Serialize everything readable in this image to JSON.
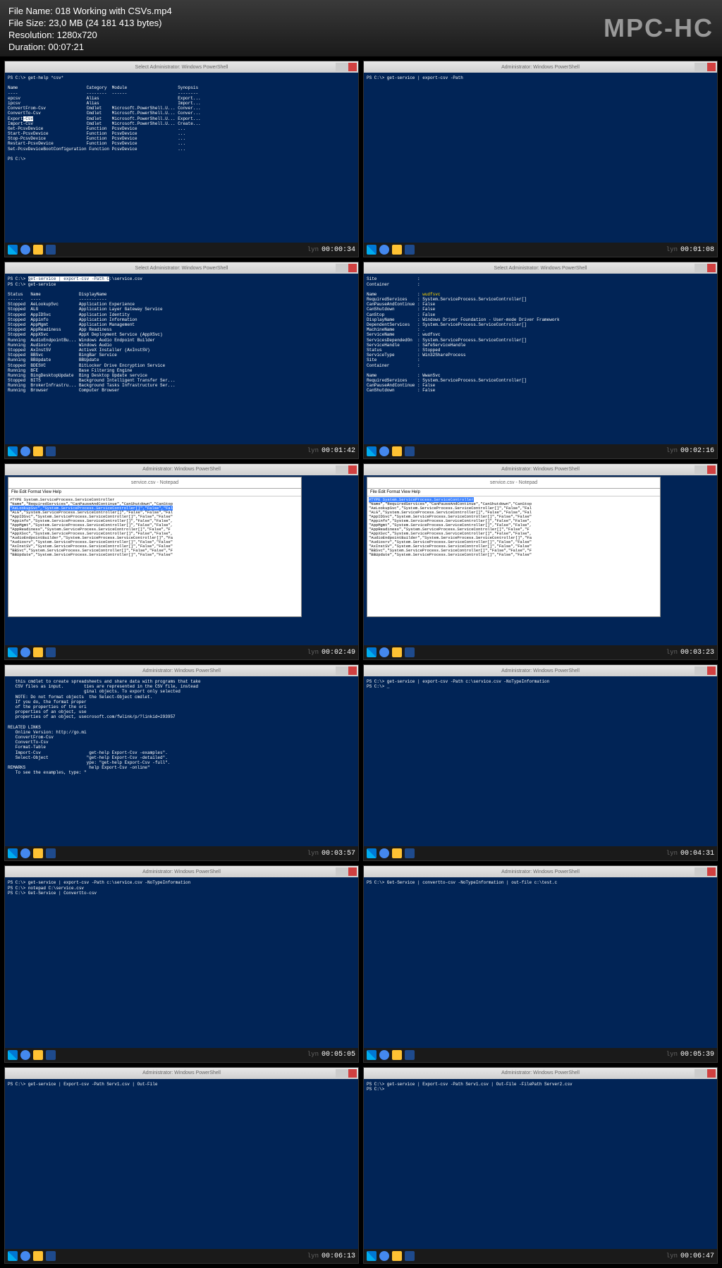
{
  "header": {
    "file_name": "File Name: 018 Working with CSVs.mp4",
    "file_size": "File Size: 23,0 MB (24 181 413 bytes)",
    "resolution": "Resolution: 1280x720",
    "duration": "Duration: 00:07:21",
    "logo": "MPC-HC"
  },
  "titlebars": {
    "ps": "Select Administrator: Windows PowerShell",
    "admin": "Administrator: Windows PowerShell",
    "np": "service.csv - Notepad",
    "np_menu": "File  Edit  Format  View  Help"
  },
  "thumbs": [
    {
      "ts": "00:00:34",
      "t": "ps",
      "body": "PS C:\\> get-help *csv*\n\nName                           Category  Module                    Synopsis\n----                           --------  ------                    --------\nepcsv                          Alias                               Export...\nipcsv                          Alias                               Import...\nConvertFrom-Csv                Cmdlet    Microsoft.PowerShell.U... Conver...\nConvertTo-Csv                  Cmdlet    Microsoft.PowerShell.U... Conver...\nExport-Csv                     Cmdlet    Microsoft.PowerShell.U... Export...\nImport-Csv                     Cmdlet    Microsoft.PowerShell.U... Create...\nGet-PcsvDevice                 Function  PcsvDevice                ...\nStart-PcsvDevice               Function  PcsvDevice                ...\nStop-PcsvDevice                Function  PcsvDevice                ...\nRestart-PcsvDevice             Function  PcsvDevice                ...\nSet-PcsvDeviceBootConfiguration Function PcsvDevice                ...\n\nPS C:\\>"
    },
    {
      "ts": "00:01:08",
      "t": "admin",
      "body": "PS C:\\> get-service | export-csv -Path"
    },
    {
      "ts": "00:01:42",
      "t": "ps",
      "body": "PS C:\\> get-service | export-csv -Path C:\\service.csv\nPS C:\\> get-service\n\nStatus   Name               DisplayName\n------   ----               -----------\nStopped  AeLookupSvc        Application Experience\nStopped  ALG                Application Layer Gateway Service\nStopped  AppIDSvc           Application Identity\nStopped  Appinfo            Application Information\nStopped  AppMgmt            Application Management\nStopped  AppReadiness       App Readiness\nStopped  AppXSvc            AppX Deployment Service (AppXSvc)\nRunning  AudioEndpointBu... Windows Audio Endpoint Builder\nRunning  Audiosrv           Windows Audio\nStopped  AxInstSV           ActiveX Installer (AxInstSV)\nStopped  BBSvc              BingBar Service\nRunning  BBUpdate           BBUpdate\nStopped  BDESVC             BitLocker Drive Encryption Service\nRunning  BFE                Base Filtering Engine\nRunning  BingDesktopUpdate  Bing Desktop Update service\nStopped  BITS               Background Intelligent Transfer Ser...\nRunning  BrokerInfrastru... Background Tasks Infrastructure Ser...\nRunning  Browser            Computer Browser"
    },
    {
      "ts": "00:02:16",
      "t": "ps",
      "body": "Site                :\nContainer           :\n\nName                : wudfsvc\nRequiredServices    : System.ServiceProcess.ServiceController[]\nCanPauseAndContinue : False\nCanShutdown         : False\nCanStop             : False\nDisplayName         : Windows Driver Foundation - User-mode Driver Framework\nDependentServices   : System.ServiceProcess.ServiceController[]\nMachineName         : .\nServiceName         : wudfsvc\nServicesDependedOn  : System.ServiceProcess.ServiceController[]\nServiceHandle       : SafeServiceHandle\nStatus              : Stopped\nServiceType         : Win32ShareProcess\nSite                :\nContainer           :\n\nName                : WwanSvc\nRequiredServices    : System.ServiceProcess.ServiceController[]\nCanPauseAndContinue : False\nCanShutdown         : False"
    },
    {
      "ts": "00:02:49",
      "t": "np",
      "body": "#TYPE System.ServiceProcess.ServiceController\n\"Name\",\"RequiredServices\",\"CanPauseAndContinue\",\"CanShutdown\",\"CanStop\n\"AeLookupSvc\",\"System.ServiceProcess.ServiceController[]\",\"False\",\"Fal\n\"ALG\",\"System.ServiceProcess.ServiceController[]\",\"False\",\"False\",\"Fal\n\"AppIDSvc\",\"System.ServiceProcess.ServiceController[]\",\"False\",\"False\"\n\"Appinfo\",\"System.ServiceProcess.ServiceController[]\",\"False\",\"False\",\n\"AppMgmt\",\"System.ServiceProcess.ServiceController[]\",\"False\",\"False\",\n\"AppReadiness\",\"System.ServiceProcess.ServiceController[]\",\"False\",\"F\n\"AppXSvc\",\"System.ServiceProcess.ServiceController[]\",\"False\",\"False\",\n\"AudioEndpointBuilder\",\"System.ServiceProcess.ServiceController[]\",\"Fa\n\"Audiosrv\",\"System.ServiceProcess.ServiceController[]\",\"False\",\"False\"\n\"AxInstSV\",\"System.ServiceProcess.ServiceController[]\",\"False\",\"False\"\n\"BBSvc\",\"System.ServiceProcess.ServiceController[]\",\"False\",\"False\",\"F\n\"BBUpdate\",\"System.ServiceProcess.ServiceController[]\",\"False\",\"False\"",
      "hl": "sel"
    },
    {
      "ts": "00:03:23",
      "t": "np",
      "body": "#TYPE System.ServiceProcess.ServiceController\n\"Name\",\"RequiredServices\",\"CanPauseAndContinue\",\"CanShutdown\",\"CanStop\n\"AeLookupSvc\",\"System.ServiceProcess.ServiceController[]\",\"False\",\"Fal\n\"ALG\",\"System.ServiceProcess.ServiceController[]\",\"False\",\"False\",\"Fal\n\"AppIDSvc\",\"System.ServiceProcess.ServiceController[]\",\"False\",\"False\"\n\"Appinfo\",\"System.ServiceProcess.ServiceController[]\",\"False\",\"False\",\n\"AppMgmt\",\"System.ServiceProcess.ServiceController[]\",\"False\",\"False\",\n\"AppReadiness\",\"System.ServiceProcess.ServiceController[]\",\"False\",\"F\n\"AppXSvc\",\"System.ServiceProcess.ServiceController[]\",\"False\",\"False\",\n\"AudioEndpointBuilder\",\"System.ServiceProcess.ServiceController[]\",\"Fa\n\"Audiosrv\",\"System.ServiceProcess.ServiceController[]\",\"False\",\"False\"\n\"AxInstSV\",\"System.ServiceProcess.ServiceController[]\",\"False\",\"False\"\n\"BBSvc\",\"System.ServiceProcess.ServiceController[]\",\"False\",\"False\",\"F\n\"BBUpdate\",\"System.ServiceProcess.ServiceController[]\",\"False\",\"False\"",
      "hl": "line1"
    },
    {
      "ts": "00:03:57",
      "t": "admin",
      "body": "   this cmdlet to create spreadsheets and share data with programs that take\n   CSV files as input.        ties are represented in the CSV file, instead\n                              ginal objects. To export only selected\n   NOTE: Do not format objects  the Select-Object cmdlet.\n   If you do, the format proper\n   of the properties of the ori\n   properties of an object, use\n   properties of an object, usecrosoft.com/fwlink/p/?linkid=293957\n\nRELATED LINKS\n   Online Version: http://go.mi\n   ConvertFrom-Csv\n   ConvertTo-Csv\n   Format-Table\n   Import-Csv                   get-help Export-Csv -examples\".\n   Select-Object               \"get-help Export-Csv -detailed\".\n                               ype: \"get-help Export-Csv -full\".\nREMARKS                         help Export-Csv -online\"\n   To see the examples, type: \""
    },
    {
      "ts": "00:04:31",
      "t": "admin",
      "body": "PS C:\\> get-service | export-csv -Path c:\\service.csv -NoTypeInformation\nPS C:\\> _"
    },
    {
      "ts": "00:05:05",
      "t": "admin",
      "body": "PS C:\\> get-service | export-csv -Path c:\\service.csv -NoTypeInformation\nPS C:\\> notepad C:\\service.csv\nPS C:\\> Get-Service | Convertto-csv"
    },
    {
      "ts": "00:05:39",
      "t": "admin",
      "body": "PS C:\\> Get-Service | convertto-csv -NoTypeInformation | out-file c:\\test.c"
    },
    {
      "ts": "00:06:13",
      "t": "admin",
      "body": "PS C:\\> get-service | Export-csv -Path Serv1.csv | Out-File"
    },
    {
      "ts": "00:06:47",
      "t": "admin",
      "body": "PS C:\\> get-service | Export-csv -Path Serv1.csv | Out-File -FilePath Server2.csv\nPS C:\\>"
    }
  ]
}
